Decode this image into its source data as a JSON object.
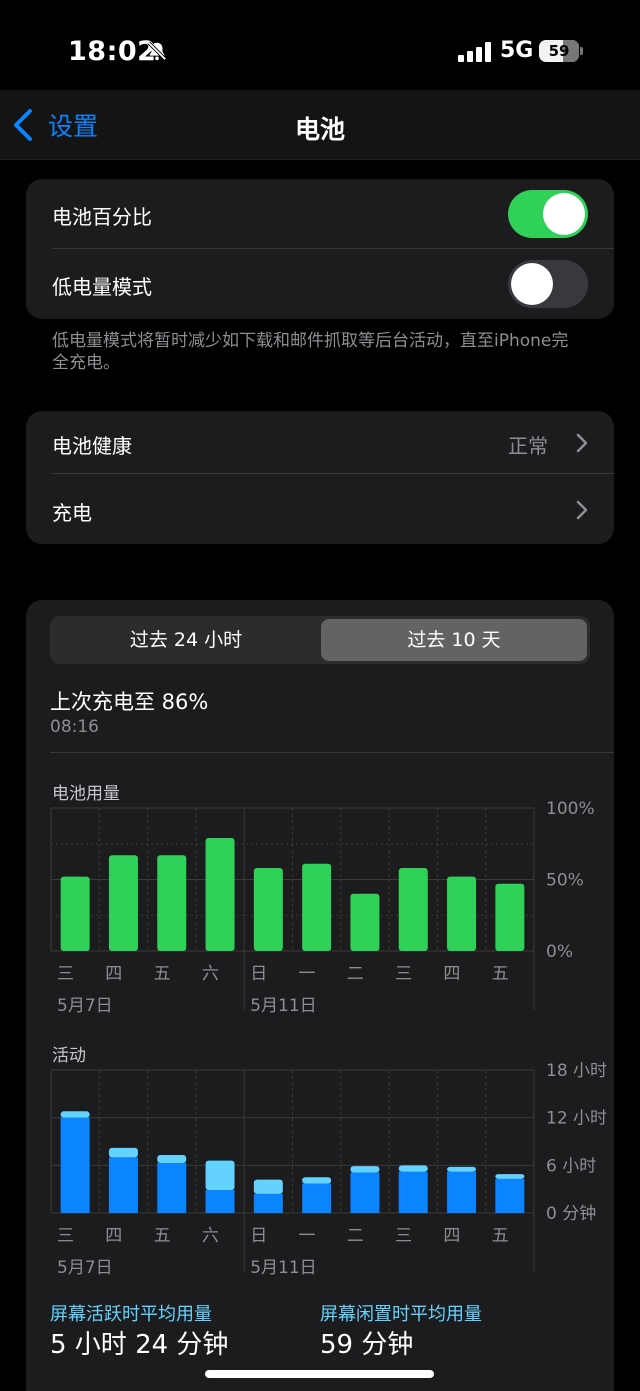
{
  "status": {
    "time": "18:02",
    "network": "5G",
    "battery": "59"
  },
  "nav": {
    "back_label": "设置",
    "title": "电池"
  },
  "toggles": {
    "percentage_label": "电池百分比",
    "percentage_on": true,
    "low_power_label": "低电量模式",
    "low_power_on": false,
    "footnote": "低电量模式将暂时减少如下载和邮件抓取等后台活动，直至iPhone完全充电。"
  },
  "health": {
    "health_label": "电池健康",
    "health_value": "正常",
    "charging_label": "充电"
  },
  "usage": {
    "tabs": [
      "过去 24 小时",
      "过去 10 天"
    ],
    "active_tab": 1,
    "last_charge": "上次充电至 86%",
    "last_charge_time": "08:16",
    "battery_chart_title": "电池用量",
    "activity_chart_title": "活动",
    "avg_active_label": "屏幕活跃时平均用量",
    "avg_active_value": "5 小时 24 分钟",
    "avg_idle_label": "屏幕闲置时平均用量",
    "avg_idle_value": "59 分钟"
  },
  "chart_data": [
    {
      "type": "bar",
      "title": "电池用量",
      "categories": [
        "三",
        "四",
        "五",
        "六",
        "日",
        "一",
        "二",
        "三",
        "四",
        "五"
      ],
      "date_labels": [
        {
          "index": 0,
          "label": "5月7日"
        },
        {
          "index": 4,
          "label": "5月11日"
        }
      ],
      "values": [
        52,
        67,
        67,
        79,
        58,
        61,
        40,
        58,
        52,
        47
      ],
      "ylim": [
        0,
        100
      ],
      "yticks": [
        "100%",
        "50%",
        "0%"
      ],
      "colors": {
        "bar": "#30d158"
      }
    },
    {
      "type": "bar",
      "title": "活动",
      "categories": [
        "三",
        "四",
        "五",
        "六",
        "日",
        "一",
        "二",
        "三",
        "四",
        "五"
      ],
      "date_labels": [
        {
          "index": 0,
          "label": "5月7日"
        },
        {
          "index": 4,
          "label": "5月11日"
        }
      ],
      "stacked": true,
      "series": [
        {
          "values": [
            12.0,
            7.0,
            6.3,
            2.9,
            2.4,
            3.7,
            5.1,
            5.2,
            5.2,
            4.3
          ]
        },
        {
          "values": [
            0.8,
            1.2,
            1.0,
            3.7,
            1.8,
            0.8,
            0.8,
            0.8,
            0.6,
            0.6
          ]
        }
      ],
      "ylim": [
        0,
        18
      ],
      "yticks": [
        "18 小时",
        "12 小时",
        "6 小时",
        "0 分钟"
      ],
      "colors": {
        "screen_on": "#0a84ff",
        "screen_off": "#64d2ff"
      }
    }
  ]
}
